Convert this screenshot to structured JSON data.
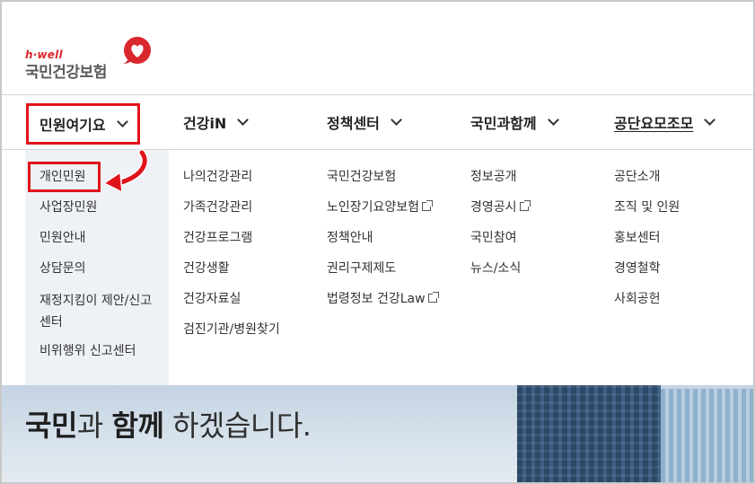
{
  "logo": {
    "tagline": "h·well",
    "name": "국민건강보험"
  },
  "nav": [
    {
      "label": "민원여기요"
    },
    {
      "label": "건강iN"
    },
    {
      "label": "정책센터"
    },
    {
      "label": "국민과함께"
    },
    {
      "label": "공단요모조모"
    }
  ],
  "menu": {
    "col0": [
      "개인민원",
      "사업장민원",
      "민원안내",
      "상담문의",
      "재정지킴이 제안/신고센터",
      "비위행위 신고센터"
    ],
    "col1": [
      "나의건강관리",
      "가족건강관리",
      "건강프로그램",
      "건강생활",
      "건강자료실",
      "검진기관/병원찾기"
    ],
    "col2": [
      "국민건강보험",
      "노인장기요양보험",
      "정책안내",
      "권리구제제도",
      "법령정보 건강Law"
    ],
    "col3": [
      "정보공개",
      "경영공시",
      "국민참여",
      "뉴스/소식"
    ],
    "col4": [
      "공단소개",
      "조직 및 인원",
      "홍보센터",
      "경영철학",
      "사회공헌"
    ]
  },
  "banner": {
    "word1": "국민",
    "word2": "과 ",
    "word3": "함께",
    "word4": " 하겠습니다."
  },
  "colors": {
    "accent_red": "#e0131a",
    "brand_red": "#d9272e",
    "menu_bg": "#eef1f6"
  },
  "icons": [
    "heart-logo-icon",
    "chevron-down-icon",
    "external-link-icon",
    "red-arrow-annotation"
  ]
}
